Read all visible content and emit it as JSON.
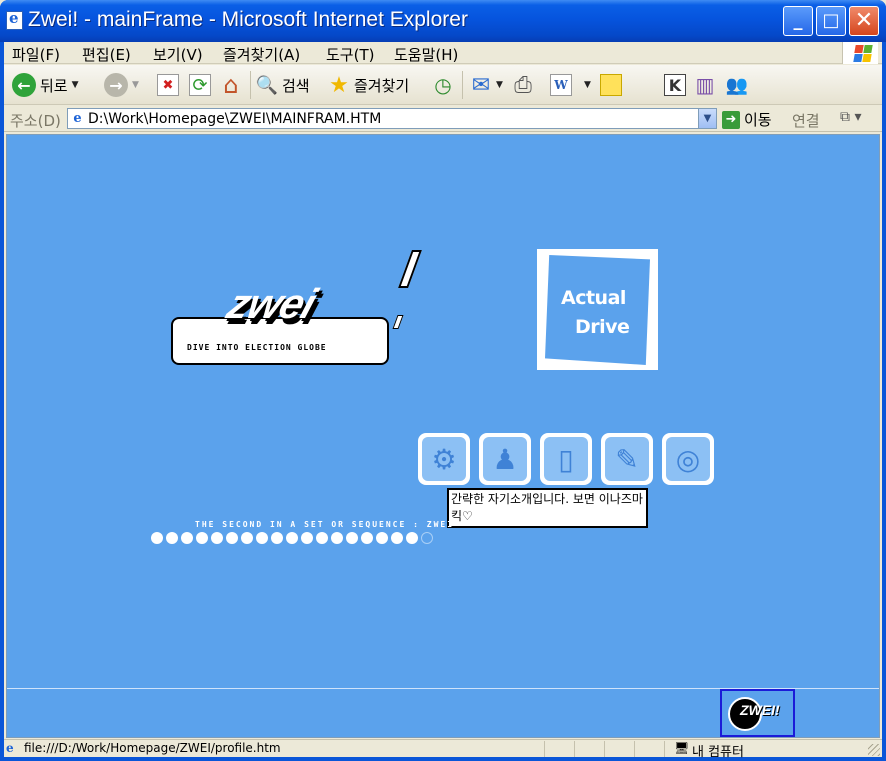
{
  "window": {
    "title": "Zwei! - mainFrame - Microsoft Internet Explorer",
    "minimize": "_",
    "maximize": "□",
    "close": "✕"
  },
  "menubar": {
    "items": [
      {
        "label": "파일(F)"
      },
      {
        "label": "편집(E)"
      },
      {
        "label": "보기(V)"
      },
      {
        "label": "즐겨찾기(A)"
      },
      {
        "label": "도구(T)"
      },
      {
        "label": "도움말(H)"
      }
    ]
  },
  "toolbar": {
    "back_label": "뒤로",
    "search_label": "검색",
    "favorites_label": "즐겨찾기",
    "back_icon": "←",
    "forward_icon": "→",
    "stop_icon": "✖",
    "refresh_icon": "⟳",
    "home_icon": "⌂",
    "search_icon": "🔍",
    "favorites_icon": "★",
    "history_icon": "◷",
    "mail_icon": "✉",
    "print_icon": "⎙",
    "edit_icon": "W",
    "note_icon": "▭",
    "k_icon": "K",
    "research_icon": "▥",
    "messenger_icon": "👥"
  },
  "address": {
    "label": "주소(D)",
    "value": "D:\\Work\\Homepage\\ZWEI\\MAINFRAM.HTM",
    "go_label": "이동",
    "links_label": "연결"
  },
  "page": {
    "logo_word": "zwei",
    "logo_tagline": "DIVE INTO ELECTION GLOBE",
    "drive_line1": "Actual",
    "drive_line2": "Drive",
    "menu_icons": [
      "robot-icon",
      "figure-icon",
      "phone-icon",
      "book-icon",
      "globe-icon"
    ],
    "tooltip": "간략한 자기소개입니다. 보면 이나즈마킥♡",
    "sequence_text": "THE SECOND IN A SET OR SEQUENCE : ZWEI",
    "dots_filled": 18,
    "dots_total": 19,
    "badge_text": "ZWEI!"
  },
  "statusbar": {
    "text": "file:///D:/Work/Homepage/ZWEI/profile.htm",
    "zone": "내 컴퓨터"
  },
  "colors": {
    "page_bg": "#5ba2ec",
    "titlebar": "#0654de",
    "chrome": "#ece9d8"
  }
}
